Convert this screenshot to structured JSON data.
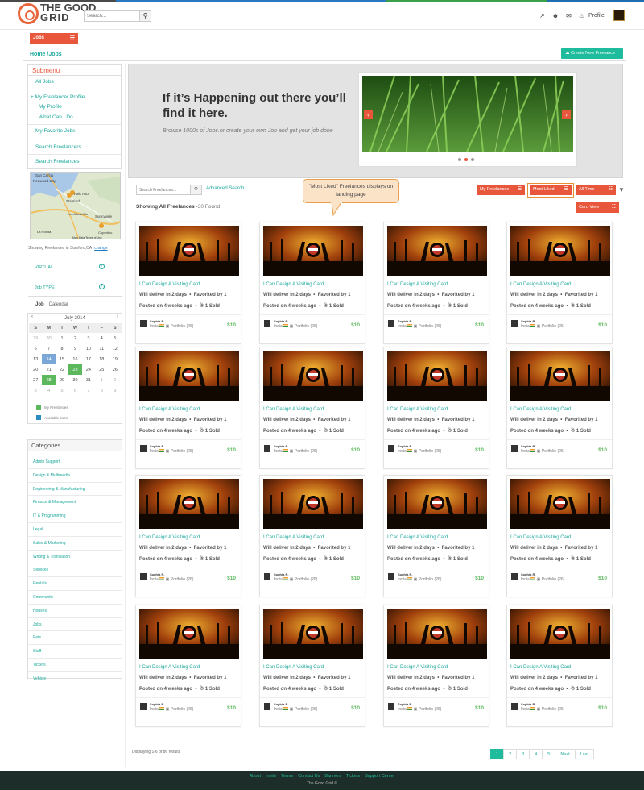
{
  "brand": {
    "line1": "THE GOOD",
    "line2": "GRID"
  },
  "header": {
    "search_placeholder": "Search...",
    "profile_label": "Profile"
  },
  "jobs_tab": "Jobs",
  "breadcrumb": "Home /Jobs",
  "create_button": "Create New Freelance",
  "submenu": {
    "title": "Submenu",
    "all_jobs": "All Jobs",
    "my_freelancer_profile": "+ My Freelancer Profile",
    "my_profile": "My Profile",
    "what_can_i_do": "What Can I Do",
    "favorite_jobs": "My Favorite Jobs",
    "search_freelancers": "Search Freelancers",
    "search_freelances": "Search Freelances"
  },
  "map": {
    "labels": [
      "San Carlos",
      "Redwood City",
      "Palo Alto",
      "Stanford",
      "Los Altos Hills",
      "Sunnyvale",
      "La Honda",
      "Cupertino"
    ],
    "footer": "Map Data  Terms of Use"
  },
  "location": {
    "text": "Showing Freelances in Stanford,CA",
    "change": "change"
  },
  "filters": {
    "virtual": "VIRTUAL",
    "job_type": "Job  TYPE"
  },
  "job_tabs": {
    "job": "Job",
    "calendar": "Calendar"
  },
  "calendar": {
    "month": "July 2014",
    "weekdays": [
      "S",
      "M",
      "T",
      "W",
      "T",
      "F",
      "S"
    ],
    "rows": [
      [
        "29",
        "30",
        "1",
        "2",
        "3",
        "4",
        "5"
      ],
      [
        "6",
        "7",
        "8",
        "9",
        "10",
        "11",
        "12"
      ],
      [
        "13",
        "14",
        "15",
        "16",
        "17",
        "18",
        "19"
      ],
      [
        "20",
        "21",
        "22",
        "23",
        "24",
        "25",
        "26"
      ],
      [
        "27",
        "28",
        "29",
        "30",
        "31",
        "1",
        "2"
      ],
      [
        "3",
        "4",
        "5",
        "6",
        "7",
        "8",
        "9"
      ]
    ],
    "legend_mine": "My Freelances",
    "legend_available": "Available Jobs",
    "green_color": "#5cb85c",
    "blue_color": "#2b8cc4"
  },
  "categories": {
    "title": "Categories",
    "items": [
      "Admin Support",
      "Design & Multimedia",
      "Engineering & Manufacturing",
      "Finance & Management",
      "IT & Programming",
      "Legal",
      "Sales & Marketing",
      "Writing & Translation",
      "Services",
      "Rentals",
      "Community",
      "Houses",
      "Jobs",
      "Pets",
      "Stuff",
      "Tickets",
      "Vehicle"
    ]
  },
  "banner": {
    "headline": "If it’s Happening out there you’ll find it here.",
    "subtext": "Browse 1000s of Jobs.or create your own Job and get your job done"
  },
  "listing": {
    "search_placeholder": "Search Freelances...",
    "advanced": "Advanced Search",
    "my_freelances": "My Freelances",
    "most_liked": "Most Liked",
    "all_time": "All Time",
    "card_view": "Card View",
    "showing_label": "Showing All Freelances -",
    "found": "30 Found",
    "callout": "\"Most Liked\" Freelances displays on landing page"
  },
  "card": {
    "title": "I Can Design A Visiting Card",
    "deliver": "Will deliver in 2 days",
    "favorited": "Favorited by 1",
    "posted": "Posted on 4 weeks ago",
    "sold": "1 Sold",
    "seller": "Sophia R.",
    "country": "India",
    "portfolio": "Portfolio (26)",
    "price": "$10"
  },
  "pagination": {
    "info": "Displaying 1-6 of 86 results",
    "pages": [
      "1",
      "2",
      "3",
      "4",
      "5",
      "Next",
      "Last"
    ]
  },
  "footer": {
    "links": [
      "About",
      "Invite",
      "Terms",
      "Contact Us",
      "Banners",
      "Tickets",
      "Support Center"
    ],
    "copyright": "The Good Grid ©"
  },
  "accent": "#e8573c",
  "teal": "#1ebc9c"
}
